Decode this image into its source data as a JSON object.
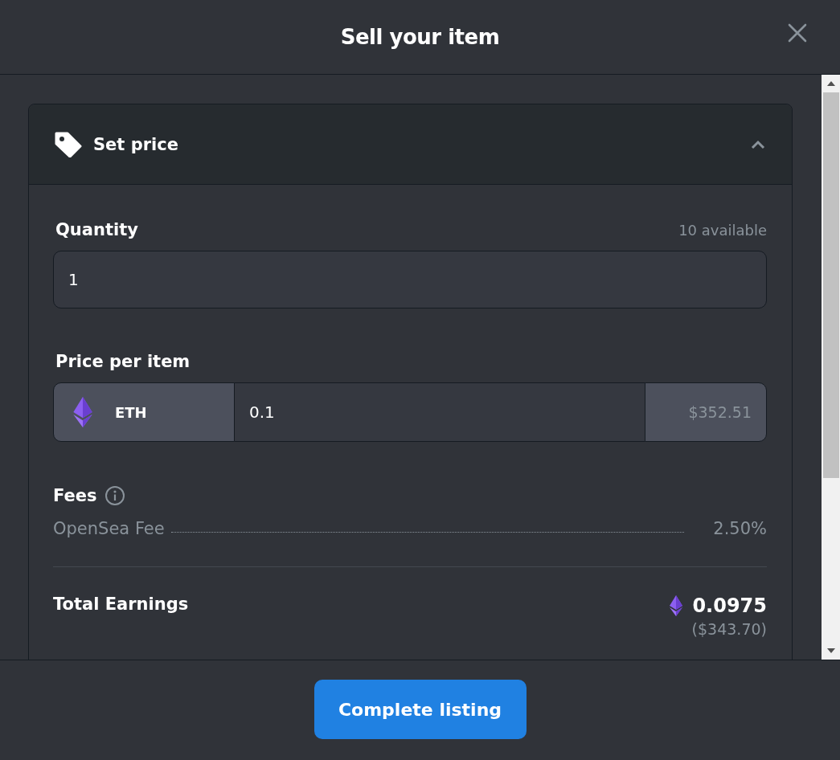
{
  "dialog": {
    "title": "Sell your item"
  },
  "section": {
    "title": "Set price",
    "expanded": true
  },
  "quantity": {
    "label": "Quantity",
    "available": "10 available",
    "value": "1"
  },
  "price": {
    "label": "Price per item",
    "currency": "ETH",
    "value": "0.1",
    "usd": "$352.51"
  },
  "fees": {
    "label": "Fees",
    "items": [
      {
        "name": "OpenSea Fee",
        "value": "2.50%"
      }
    ]
  },
  "total": {
    "label": "Total Earnings",
    "amount": "0.0975",
    "usd": "($343.70)"
  },
  "action": {
    "label": "Complete listing"
  }
}
